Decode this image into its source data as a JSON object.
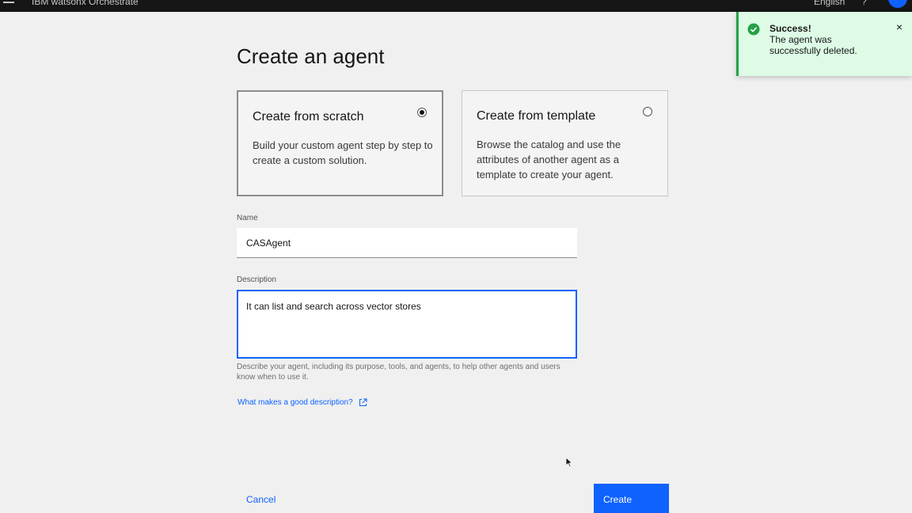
{
  "header": {
    "brand": "IBM watsonx Orchestrate",
    "language": "English",
    "help": "?"
  },
  "page": {
    "title": "Create an agent"
  },
  "options": [
    {
      "title": "Create from scratch",
      "description": "Build your custom agent step by step to create a custom solution.",
      "selected": true
    },
    {
      "title": "Create from template",
      "description": "Browse the catalog and use the attributes of another agent as a template to create your agent.",
      "selected": false
    }
  ],
  "form": {
    "name_label": "Name",
    "name_value": "CASAgent",
    "description_label": "Description",
    "description_value": "It can list and search across vector stores",
    "description_helper": "Describe your agent, including its purpose, tools, and agents, to help other agents and users know when to use it.",
    "help_link": "What makes a good description?"
  },
  "actions": {
    "cancel": "Cancel",
    "create": "Create"
  },
  "toast": {
    "title": "Success!",
    "message": "The agent was successfully deleted.",
    "close": "×"
  },
  "colors": {
    "primary": "#0f62fe",
    "success": "#24a148",
    "toast_bg": "#defbe6"
  }
}
